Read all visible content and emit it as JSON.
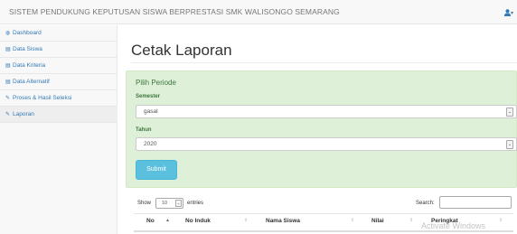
{
  "app": {
    "title": "SISTEM PENDUKUNG KEPUTUSAN SISWA BERPRESTASI SMK WALISONGO SEMARANG",
    "user_caret": "▾"
  },
  "sidebar": {
    "items": [
      {
        "icon": "dashboard-icon",
        "glyph": "◍",
        "label": "Dashboard"
      },
      {
        "icon": "table-icon",
        "glyph": "▤",
        "label": "Data Siswa"
      },
      {
        "icon": "table-icon",
        "glyph": "▤",
        "label": "Data Kriteria"
      },
      {
        "icon": "table-icon",
        "glyph": "▤",
        "label": "Data Alternatif"
      },
      {
        "icon": "edit-icon",
        "glyph": "✎",
        "label": "Proses & Hasil Seleksi"
      },
      {
        "icon": "edit-icon",
        "glyph": "✎",
        "label": "Laporan",
        "active": true
      }
    ]
  },
  "main": {
    "page_title": "Cetak Laporan",
    "panel": {
      "heading": "Pilih Periode",
      "semester_label": "Semester",
      "semester_value": "gasal",
      "tahun_label": "Tahun",
      "tahun_value": "2020",
      "submit_label": "Submit"
    },
    "table_controls": {
      "show_label": "Show",
      "length_value": "10",
      "entries_label": "entries",
      "search_label": "Search:"
    },
    "table": {
      "headers": [
        "No",
        "No Induk",
        "Nama Siswa",
        "Nilai",
        "Peringkat"
      ]
    }
  },
  "overlay": {
    "watermark": "Activate Windows"
  },
  "colors": {
    "link": "#337ab7",
    "panel_bg": "#dff0d8",
    "panel_text": "#3c763d",
    "button": "#5bc0de"
  }
}
